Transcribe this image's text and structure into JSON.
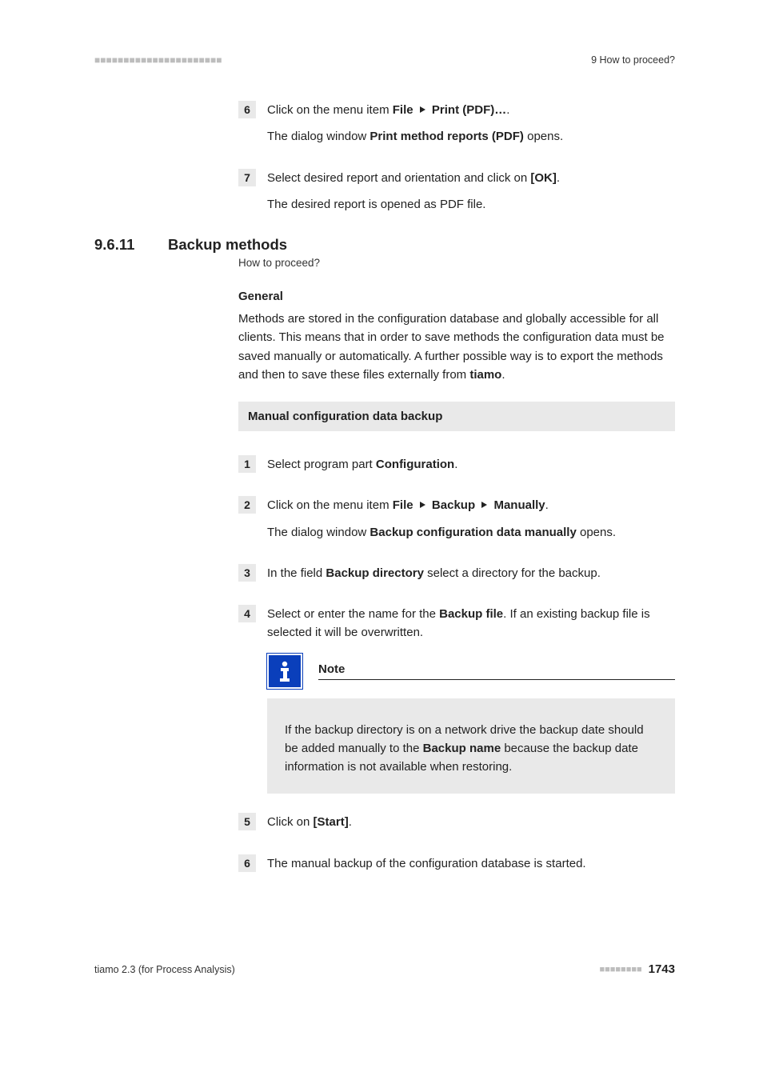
{
  "header": {
    "right": "9 How to proceed?"
  },
  "prev_steps": {
    "s6": {
      "num": "6",
      "pre": "Click on the menu item ",
      "b1": "File",
      "b2": "Print (PDF)…",
      "post": ".",
      "sub_pre": "The dialog window ",
      "sub_b": "Print method reports (PDF)",
      "sub_post": " opens."
    },
    "s7": {
      "num": "7",
      "pre": "Select desired report and orientation and click on ",
      "b1": "[OK]",
      "post": ".",
      "sub": "The desired report is opened as PDF file."
    }
  },
  "section": {
    "num": "9.6.11",
    "title": "Backup methods",
    "breadcrumb": "How to proceed?"
  },
  "general": {
    "heading": "General",
    "text_pre": "Methods are stored in the configuration database and globally accessible for all clients. This means that in order to save methods the configuration data must be saved manually or automatically. A further possible way is to export the methods and then to save these files externally from ",
    "text_b": "tiamo",
    "text_post": "."
  },
  "band": "Manual configuration data backup",
  "steps": {
    "s1": {
      "num": "1",
      "pre": "Select program part ",
      "b1": "Configuration",
      "post": "."
    },
    "s2": {
      "num": "2",
      "pre": "Click on the menu item ",
      "b1": "File",
      "b2": "Backup",
      "b3": "Manually",
      "post": ".",
      "sub_pre": "The dialog window ",
      "sub_b": "Backup configuration data manually",
      "sub_post": " opens."
    },
    "s3": {
      "num": "3",
      "pre": "In the field ",
      "b1": "Backup directory",
      "post": " select a directory for the backup."
    },
    "s4": {
      "num": "4",
      "pre": "Select or enter the name for the ",
      "b1": "Backup file",
      "post": ". If an existing backup file is selected it will be overwritten."
    },
    "s5": {
      "num": "5",
      "pre": "Click on ",
      "b1": "[Start]",
      "post": "."
    },
    "s6": {
      "num": "6",
      "text": "The manual backup of the configuration database is started."
    }
  },
  "note": {
    "title": "Note",
    "body_pre": "If the backup directory is on a network drive the backup date should be added manually to the ",
    "body_b": "Backup name",
    "body_post": " because the backup date information is not available when restoring."
  },
  "footer": {
    "left": "tiamo 2.3 (for Process Analysis)",
    "page": "1743"
  }
}
